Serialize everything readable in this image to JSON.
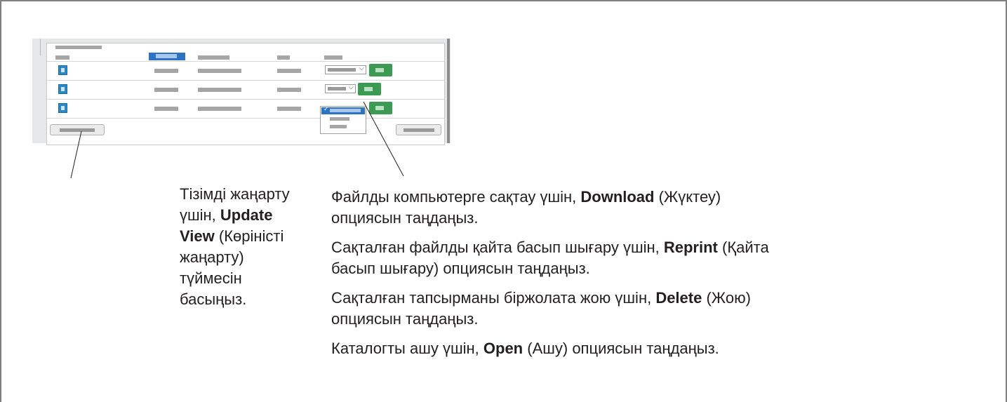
{
  "left_caption": {
    "pre": "Тізімді жаңарту үшін, ",
    "bold": "Update View",
    "post": " (Көріністі жаңарту) түймесін басыңыз."
  },
  "right_captions": [
    {
      "pre": "Файлды компьютерге сақтау үшін, ",
      "bold": "Download",
      "post": " (Жүктеу) опциясын таңдаңыз."
    },
    {
      "pre": "Сақталған файлды қайта басып шығару үшін, ",
      "bold": "Reprint",
      "post": " (Қайта басып шығару) опциясын таңдаңыз."
    },
    {
      "pre": "Сақталған тапсырманы біржолата жою үшін, ",
      "bold": "Delete",
      "post": " (Жою) опциясын таңдаңыз."
    },
    {
      "pre": "Каталогты ашу үшін, ",
      "bold": "Open",
      "post": " (Ашу) опциясын таңдаңыз."
    }
  ],
  "mockup": {
    "rows": [
      {
        "icon": "pdf-file-icon"
      },
      {
        "icon": "folder-file-icon"
      },
      {
        "icon": "document-file-icon"
      }
    ]
  },
  "colors": {
    "accent_blue": "#2e72c4",
    "action_green": "#3d9a52",
    "frame": "#808080"
  }
}
